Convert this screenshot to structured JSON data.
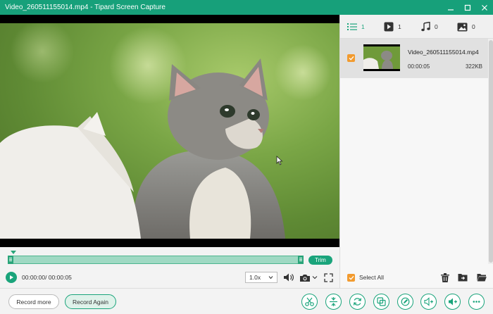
{
  "window": {
    "title": "Video_260511155014.mp4  -  Tipard Screen Capture"
  },
  "player": {
    "time": "00:00:00/ 00:00:05",
    "trim_label": "Trim",
    "speed": "1.0x"
  },
  "tabs": [
    {
      "icon": "list-icon",
      "count": "1"
    },
    {
      "icon": "video-icon",
      "count": "1"
    },
    {
      "icon": "music-icon",
      "count": "0"
    },
    {
      "icon": "image-icon",
      "count": "0"
    }
  ],
  "files": [
    {
      "name": "Video_260511155014.mp4",
      "duration": "00:00:05",
      "size": "322KB"
    }
  ],
  "panel": {
    "select_all": "Select All"
  },
  "bottom": {
    "record_more": "Record more",
    "record_again": "Record Again"
  },
  "colors": {
    "accent": "#1aa47b",
    "titlebar": "#17a07a",
    "checkbox": "#f29b2f"
  }
}
